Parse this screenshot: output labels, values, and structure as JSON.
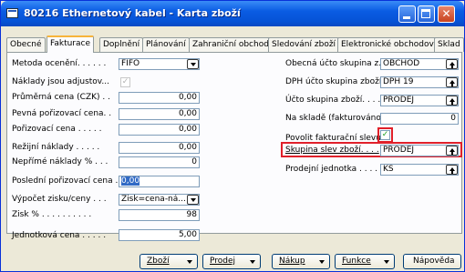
{
  "window": {
    "title": "80216 Ethernetový kabel - Karta zboží",
    "tabs": [
      "Obecné",
      "Fakturace",
      "Doplnění",
      "Plánování",
      "Zahraniční obchod",
      "Sledování zboží",
      "Elektronické obchodování",
      "Sklad"
    ],
    "active_tab": "Fakturace"
  },
  "left": {
    "metoda_oceneni": {
      "label": "Metoda ocenění. . . . . .",
      "value": "FIFO"
    },
    "naklady_jsou_adjustovany": {
      "label": "Náklady jsou adjustov...",
      "checked": true
    },
    "prumerna_cena": {
      "label": "Průměrná cena (CZK) . .",
      "value": "0,00"
    },
    "pevna_porizovaci_cena": {
      "label": "Pevná pořizovací cena. .",
      "value": "0,00"
    },
    "porizovaci_cena": {
      "label": "Pořizovací cena . . . . .",
      "value": "0,00"
    },
    "rezijni_naklady": {
      "label": "Režijní náklady . . . . .",
      "value": "0,00"
    },
    "neprime_naklady": {
      "label": "Nepřímé náklady % . . .",
      "value": "0"
    },
    "posledni_porizovaci_cena": {
      "label": "Poslední pořizovací cena .",
      "value": "0,00"
    },
    "vypocet_zisku": {
      "label": "Výpočet zisku/ceny . . .",
      "value": "Zisk=cena-ná..."
    },
    "zisk": {
      "label": "Zisk % . . . . . . . . . .",
      "value": "98"
    },
    "jednotkova_cena": {
      "label": "Jednotková cena . . . . .",
      "value": "5,00"
    }
  },
  "right": {
    "obecne_ucto_skupina": {
      "label": "Obecná účto skupina z...",
      "value": "OBCHOD"
    },
    "dph_ucto_skupina": {
      "label": "DPH účto skupina zboží.",
      "value": "DPH 19"
    },
    "ucto_skupina_zbozi": {
      "label": "Účto skupina zboží. . . .",
      "value": "PRODEJ"
    },
    "na_sklade": {
      "label": "Na skladě (fakturováno) .",
      "value": "0"
    },
    "povolit_fakturacni_slevu": {
      "label": "Povolit fakturační slevu",
      "checked": true
    },
    "skupina_slev_zbozi": {
      "label": "Skupina slev zboží. . . .",
      "value": "PRODEJ"
    },
    "prodejni_jednotka": {
      "label": "Prodejní jednotka . . . .",
      "value": "KS"
    }
  },
  "buttons": {
    "zbozi": "Zboží",
    "prodej": "Prodej",
    "nakup": "Nákup",
    "funkce": "Funkce",
    "napoveda": "Nápověda"
  },
  "colors": {
    "highlight": "#e0202a",
    "title_bar": "#0a5ce3",
    "check": "#21a121"
  }
}
